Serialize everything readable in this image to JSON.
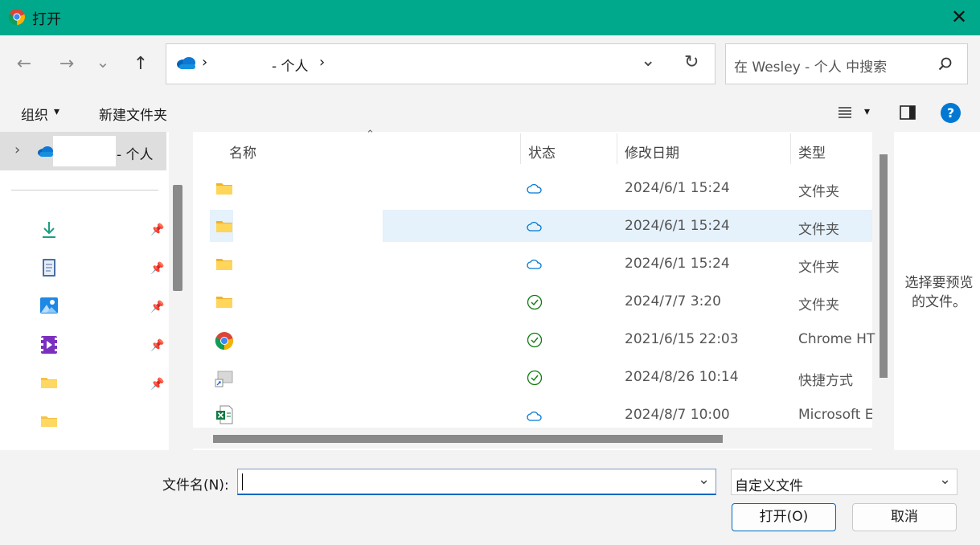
{
  "window": {
    "title": "打开",
    "close": "✕"
  },
  "nav": {
    "back": "←",
    "forward": "→",
    "recent": "⌄",
    "up": "↑"
  },
  "address": {
    "sep1": "›",
    "location": "- 个人",
    "sep2": "›",
    "dropdown": "⌄",
    "refresh": "↻"
  },
  "search": {
    "placeholder": "在 Wesley - 个人 中搜索"
  },
  "toolbar": {
    "organize": "组织",
    "organize_arrow": "▾",
    "new_folder": "新建文件夹",
    "view_arrow": "▾",
    "help": "?"
  },
  "sidebar": {
    "root": {
      "expand": "›",
      "label": "- 个人"
    }
  },
  "columns": {
    "name": "名称",
    "status": "状态",
    "modified": "修改日期",
    "type": "类型"
  },
  "files": [
    {
      "date": "2024/6/1 15:24",
      "type": "文件夹"
    },
    {
      "date": "2024/6/1 15:24",
      "type": "文件夹"
    },
    {
      "date": "2024/6/1 15:24",
      "type": "文件夹"
    },
    {
      "date": "2024/7/7 3:20",
      "type": "文件夹"
    },
    {
      "date": "2021/6/15 22:03",
      "type": "Chrome HT"
    },
    {
      "date": "2024/8/26 10:14",
      "type": "快捷方式"
    },
    {
      "date": "2024/8/7 10:00",
      "type": "Microsoft E"
    }
  ],
  "preview": {
    "text": "选择要预览的文件。"
  },
  "footer": {
    "filename_label": "文件名(N):",
    "filename_value": "",
    "filename_arrow": "⌄",
    "filetype_value": "自定义文件",
    "filetype_arrow": "⌄",
    "open_button": "打开(O)",
    "cancel_button": "取消"
  },
  "colors": {
    "accent": "#00a98c",
    "selection": "#e5f1fb",
    "primary_border": "#0067c0"
  }
}
